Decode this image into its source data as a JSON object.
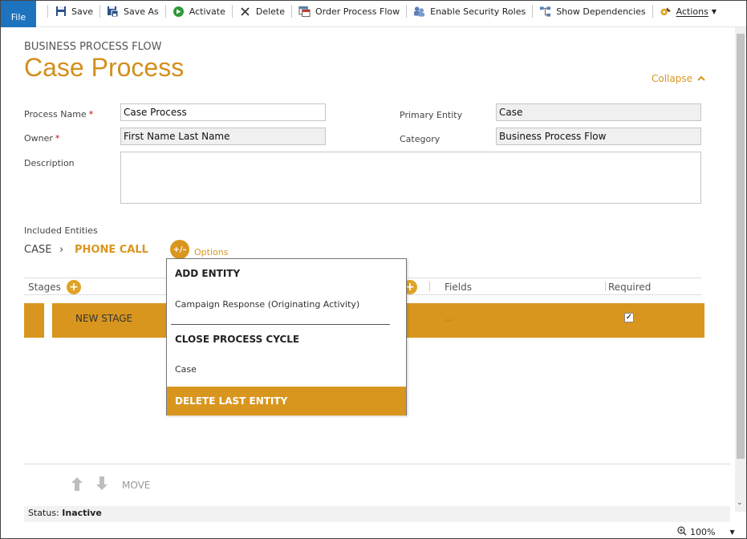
{
  "toolbar": {
    "file": "File",
    "save": "Save",
    "save_as": "Save As",
    "activate": "Activate",
    "delete": "Delete",
    "order_process_flow": "Order Process Flow",
    "enable_security_roles": "Enable Security Roles",
    "show_dependencies": "Show Dependencies",
    "actions": "Actions"
  },
  "header": {
    "subtitle": "BUSINESS PROCESS FLOW",
    "title": "Case Process",
    "collapse": "Collapse"
  },
  "form": {
    "process_name_label": "Process Name",
    "process_name_value": "Case Process",
    "owner_label": "Owner",
    "owner_value": "First Name Last Name",
    "description_label": "Description",
    "description_value": "",
    "primary_entity_label": "Primary Entity",
    "primary_entity_value": "Case",
    "category_label": "Category",
    "category_value": "Business Process Flow",
    "required_marker": "*"
  },
  "entities": {
    "label": "Included Entities",
    "items": [
      "CASE",
      "PHONE CALL"
    ],
    "options_button": "+/–",
    "options_label": "Options"
  },
  "stages": {
    "header_stages": "Stages",
    "header_fields": "Fields",
    "header_required": "Required",
    "rows": [
      {
        "name": "NEW STAGE",
        "field": "--",
        "required": true
      }
    ]
  },
  "options_menu": {
    "add_entity_heading": "ADD ENTITY",
    "add_entity_item": "Campaign Response (Originating Activity)",
    "close_cycle_heading": "CLOSE PROCESS CYCLE",
    "close_cycle_item": "Case",
    "delete_last_entity": "DELETE LAST ENTITY"
  },
  "bottom": {
    "move_label": "MOVE",
    "status_label": "Status:",
    "status_value": "Inactive",
    "zoom": "100%"
  },
  "colors": {
    "accent": "#d9961e",
    "file_button": "#1e73be"
  }
}
